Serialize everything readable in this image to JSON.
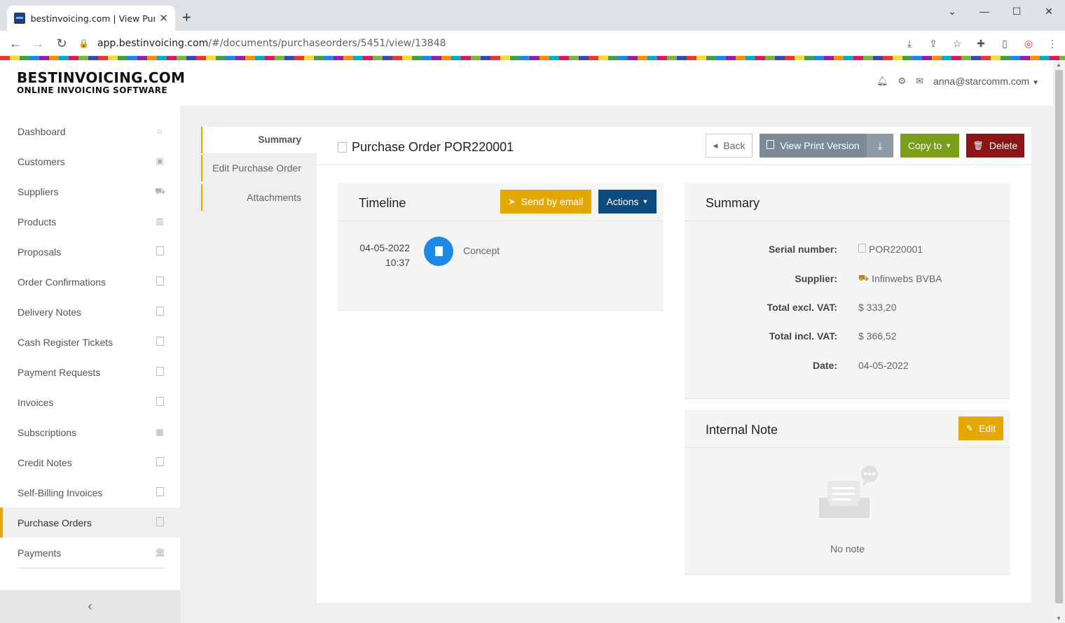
{
  "browser": {
    "tab_title": "bestinvoicing.com | View Purchase Order",
    "url_host": "app.bestinvoicing.com",
    "url_path": "/#/documents/purchaseorders/5451/view/13848"
  },
  "app": {
    "logo_line1": "BESTINVOICING.COM",
    "logo_line2": "ONLINE INVOICING SOFTWARE",
    "user_email": "anna@starcomm.com"
  },
  "sidebar": {
    "items": [
      {
        "label": "Dashboard",
        "icon": "home-icon"
      },
      {
        "label": "Customers",
        "icon": "contact-card-icon"
      },
      {
        "label": "Suppliers",
        "icon": "truck-icon"
      },
      {
        "label": "Products",
        "icon": "barcode-icon"
      },
      {
        "label": "Proposals",
        "icon": "pdf-file-icon"
      },
      {
        "label": "Order Confirmations",
        "icon": "pdf-file-icon"
      },
      {
        "label": "Delivery Notes",
        "icon": "pdf-file-icon"
      },
      {
        "label": "Cash Register Tickets",
        "icon": "pdf-file-icon"
      },
      {
        "label": "Payment Requests",
        "icon": "pdf-file-icon"
      },
      {
        "label": "Invoices",
        "icon": "pdf-file-icon"
      },
      {
        "label": "Subscriptions",
        "icon": "calendar-icon"
      },
      {
        "label": "Credit Notes",
        "icon": "pdf-file-icon"
      },
      {
        "label": "Self-Billing Invoices",
        "icon": "pdf-file-icon"
      },
      {
        "label": "Purchase Orders",
        "icon": "pdf-file-icon"
      },
      {
        "label": "Payments",
        "icon": "bank-icon"
      }
    ],
    "active_index": 13
  },
  "subnav": {
    "items": [
      "Summary",
      "Edit Purchase Order",
      "Attachments"
    ]
  },
  "document": {
    "title": "Purchase Order POR220001",
    "back_label": "Back",
    "print_label": "View Print Version",
    "copy_label": "Copy to",
    "delete_label": "Delete"
  },
  "timeline": {
    "title": "Timeline",
    "send_label": "Send by email",
    "actions_label": "Actions",
    "entry_date": "04-05-2022",
    "entry_time": "10:37",
    "entry_status": "Concept"
  },
  "summary": {
    "title": "Summary",
    "serial_label": "Serial number:",
    "serial_value": "POR220001",
    "supplier_label": "Supplier:",
    "supplier_value": "Infinwebs BVBA",
    "excl_label": "Total excl. VAT:",
    "excl_value": "$ 333,20",
    "incl_label": "Total incl. VAT:",
    "incl_value": "$ 366,52",
    "date_label": "Date:",
    "date_value": "04-05-2022"
  },
  "note": {
    "title": "Internal Note",
    "edit_label": "Edit",
    "empty_text": "No note"
  },
  "colors": {
    "accent": "#e5a800",
    "primary_dark": "#0d4a80",
    "danger": "#8b1414",
    "success": "#7a9d1a",
    "info": "#1e88e5"
  }
}
